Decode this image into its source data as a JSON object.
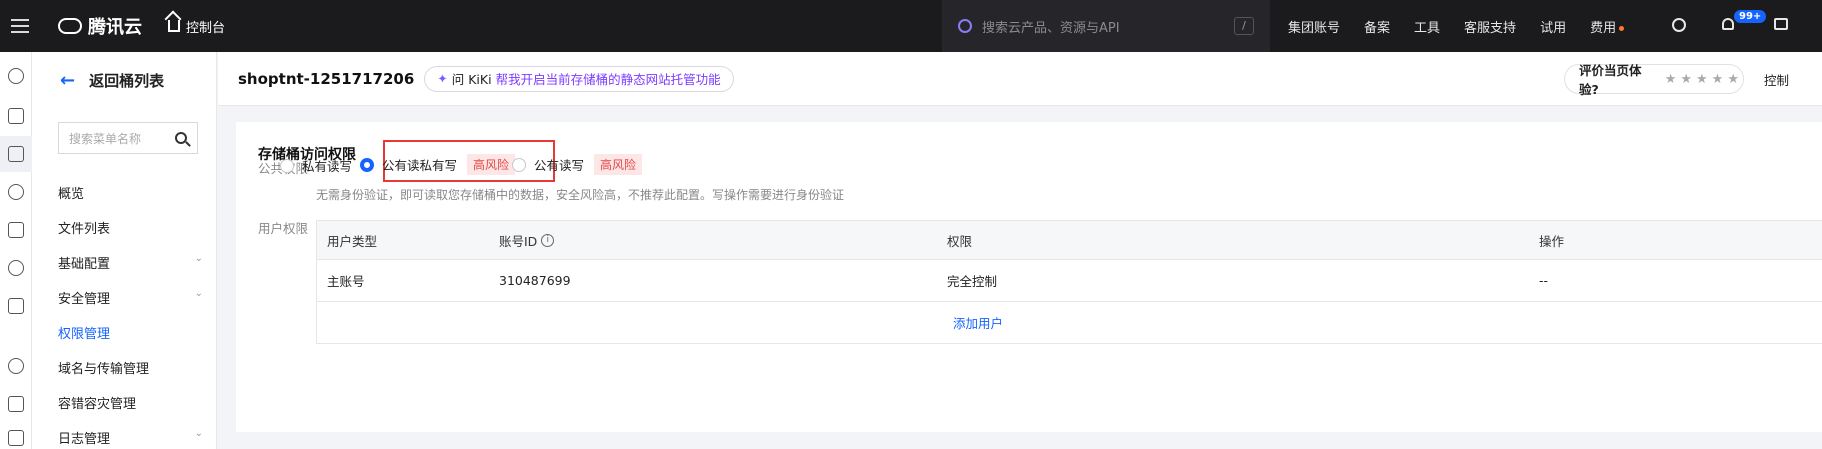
{
  "topbar": {
    "brand": "腾讯云",
    "console": "控制台",
    "search_placeholder": "搜索云产品、资源与API",
    "search_shortcut": "/",
    "nav": [
      "集团账号",
      "备案",
      "工具",
      "客服支持",
      "试用",
      "费用"
    ],
    "notification_count": "99+"
  },
  "sidebar": {
    "back_label": "返回桶列表",
    "search_placeholder": "搜索菜单名称",
    "items": [
      {
        "label": "概览",
        "expandable": false
      },
      {
        "label": "文件列表",
        "expandable": false
      },
      {
        "label": "基础配置",
        "expandable": true
      },
      {
        "label": "安全管理",
        "expandable": true
      },
      {
        "label": "权限管理",
        "expandable": false,
        "active": true
      },
      {
        "label": "域名与传输管理",
        "expandable": false
      },
      {
        "label": "容错容灾管理",
        "expandable": false
      },
      {
        "label": "日志管理",
        "expandable": true
      }
    ]
  },
  "header": {
    "bucket_name": "shoptnt-1251717206",
    "kiki_prefix": "问 KiKi",
    "kiki_link": "帮我开启当前存储桶的静态网站托管功能",
    "rating_label": "评价当页体验?",
    "rating_stars": "★★★★★",
    "right_link": "控制"
  },
  "access": {
    "title": "存储桶访问权限",
    "public_label": "公共权限",
    "options": [
      {
        "label": "私有读写",
        "selected": false,
        "risk": ""
      },
      {
        "label": "公有读私有写",
        "selected": true,
        "risk": "高风险"
      },
      {
        "label": "公有读写",
        "selected": false,
        "risk": "高风险"
      }
    ],
    "description": "无需身份验证，即可读取您存储桶中的数据，安全风险高，不推荐此配置。写操作需要进行身份验证",
    "user_label": "用户权限",
    "table": {
      "headers": [
        "用户类型",
        "账号ID",
        "权限",
        "操作"
      ],
      "rows": [
        [
          "主账号",
          "310487699",
          "完全控制",
          "--"
        ]
      ],
      "add_user": "添加用户"
    }
  }
}
